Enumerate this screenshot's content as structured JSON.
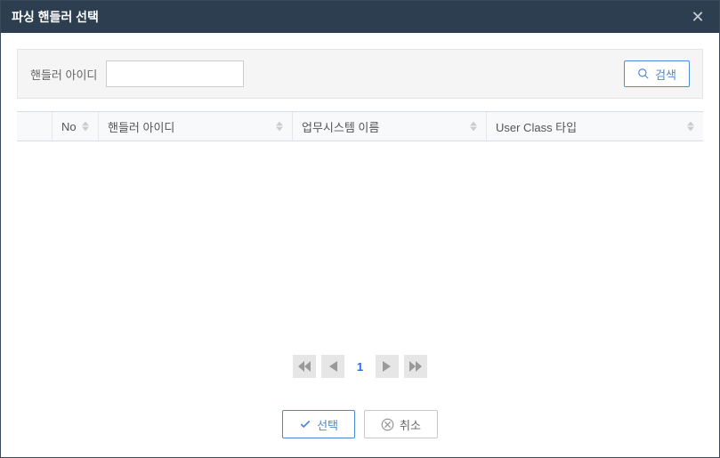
{
  "titlebar": {
    "title": "파싱 핸들러 선택"
  },
  "search": {
    "label": "핸들러 아이디",
    "value": "",
    "button_label": "검색"
  },
  "table": {
    "columns": {
      "no": "No",
      "handler_id": "핸들러 아이디",
      "system_name": "업무시스템 이름",
      "user_class": "User Class 타입"
    },
    "rows": []
  },
  "pagination": {
    "current": "1"
  },
  "footer": {
    "select_label": "선택",
    "cancel_label": "취소"
  }
}
